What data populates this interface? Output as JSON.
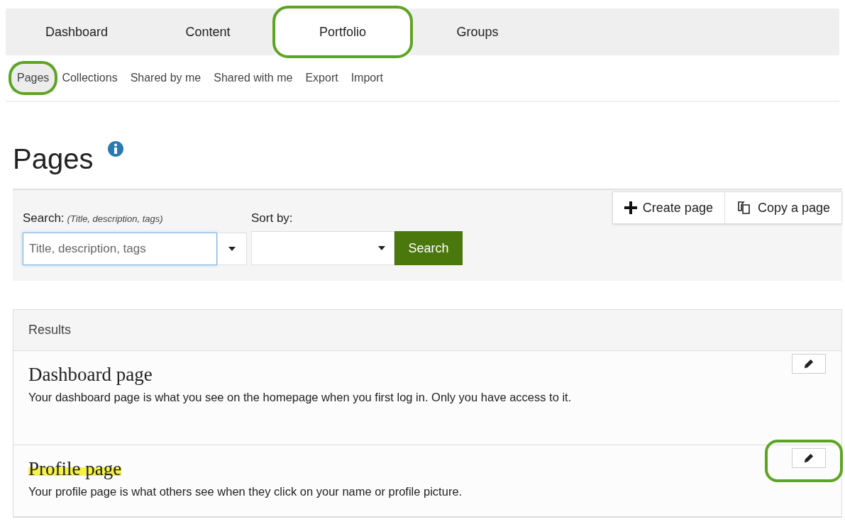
{
  "main_nav": [
    {
      "label": "Dashboard",
      "selected": false,
      "circled": false
    },
    {
      "label": "Content",
      "selected": false,
      "circled": false
    },
    {
      "label": "Portfolio",
      "selected": true,
      "circled": true
    },
    {
      "label": "Groups",
      "selected": false,
      "circled": false
    }
  ],
  "sub_nav": [
    {
      "label": "Pages",
      "selected": true,
      "circled": true
    },
    {
      "label": "Collections",
      "selected": false,
      "circled": false
    },
    {
      "label": "Shared by me",
      "selected": false,
      "circled": false
    },
    {
      "label": "Shared with me",
      "selected": false,
      "circled": false
    },
    {
      "label": "Export",
      "selected": false,
      "circled": false
    },
    {
      "label": "Import",
      "selected": false,
      "circled": false
    }
  ],
  "page_title": "Pages",
  "actions": [
    {
      "kind": "create",
      "label": "Create page"
    },
    {
      "kind": "copy",
      "label": "Copy a page"
    }
  ],
  "search": {
    "label": "Search:",
    "hint": "(Title, description, tags)",
    "placeholder": "Title, description, tags",
    "sort_label": "Sort by:",
    "button": "Search"
  },
  "results": {
    "header": "Results",
    "rows": [
      {
        "title": "Dashboard page",
        "description": "Your dashboard page is what you see on the homepage when you first log in. Only you have access to it.",
        "highlighted": false,
        "edit_circled": false
      },
      {
        "title": "Profile page",
        "description": "Your profile page is what others see when they click on your name or profile picture.",
        "highlighted": true,
        "edit_circled": true
      }
    ]
  }
}
